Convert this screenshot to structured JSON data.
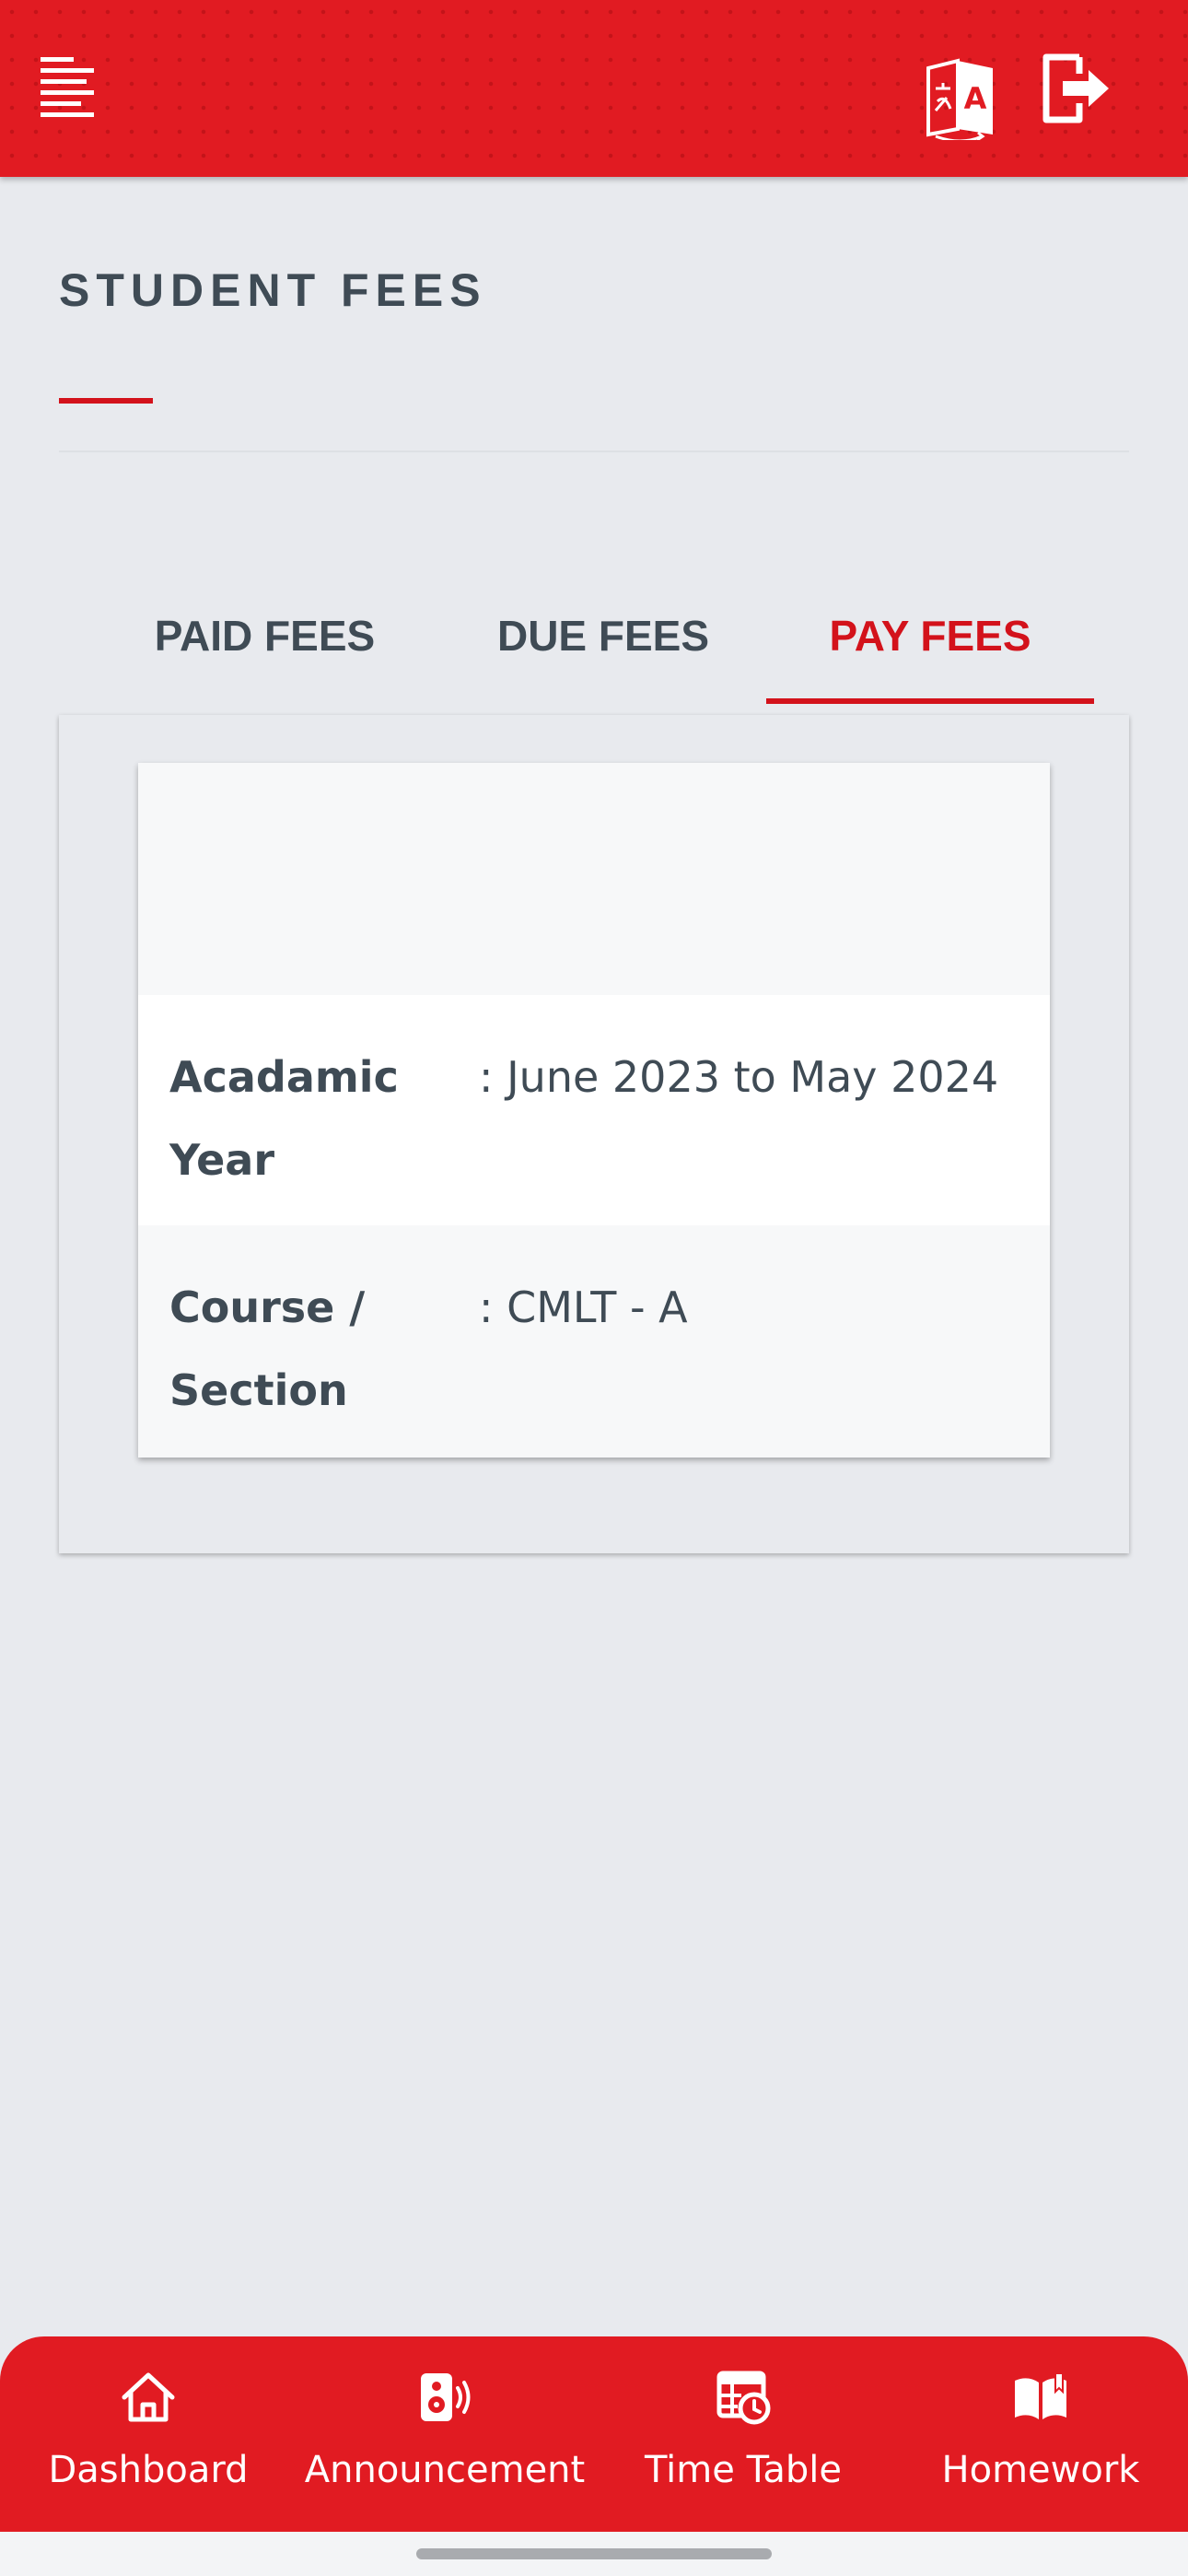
{
  "header": {
    "menu_icon": "menu-lines-icon",
    "translate_icon": "translate-icon",
    "logout_icon": "logout-icon",
    "color": "#e11b22"
  },
  "page": {
    "title": "STUDENT FEES",
    "accent_color": "#d3121b"
  },
  "tabs": [
    {
      "label": "PAID FEES",
      "active": false
    },
    {
      "label": "DUE FEES",
      "active": false
    },
    {
      "label": "PAY FEES",
      "active": true
    }
  ],
  "fee_card": {
    "rows": [
      {
        "label": "Acadamic Year",
        "value": ": June 2023 to May 2024"
      },
      {
        "label": "Course / Section",
        "value": ": CMLT - A"
      }
    ]
  },
  "bottom_nav": [
    {
      "label": "Dashboard",
      "icon": "home-icon"
    },
    {
      "label": "Announcement",
      "icon": "speaker-icon"
    },
    {
      "label": "Time Table",
      "icon": "timetable-icon"
    },
    {
      "label": "Homework",
      "icon": "book-icon"
    }
  ]
}
